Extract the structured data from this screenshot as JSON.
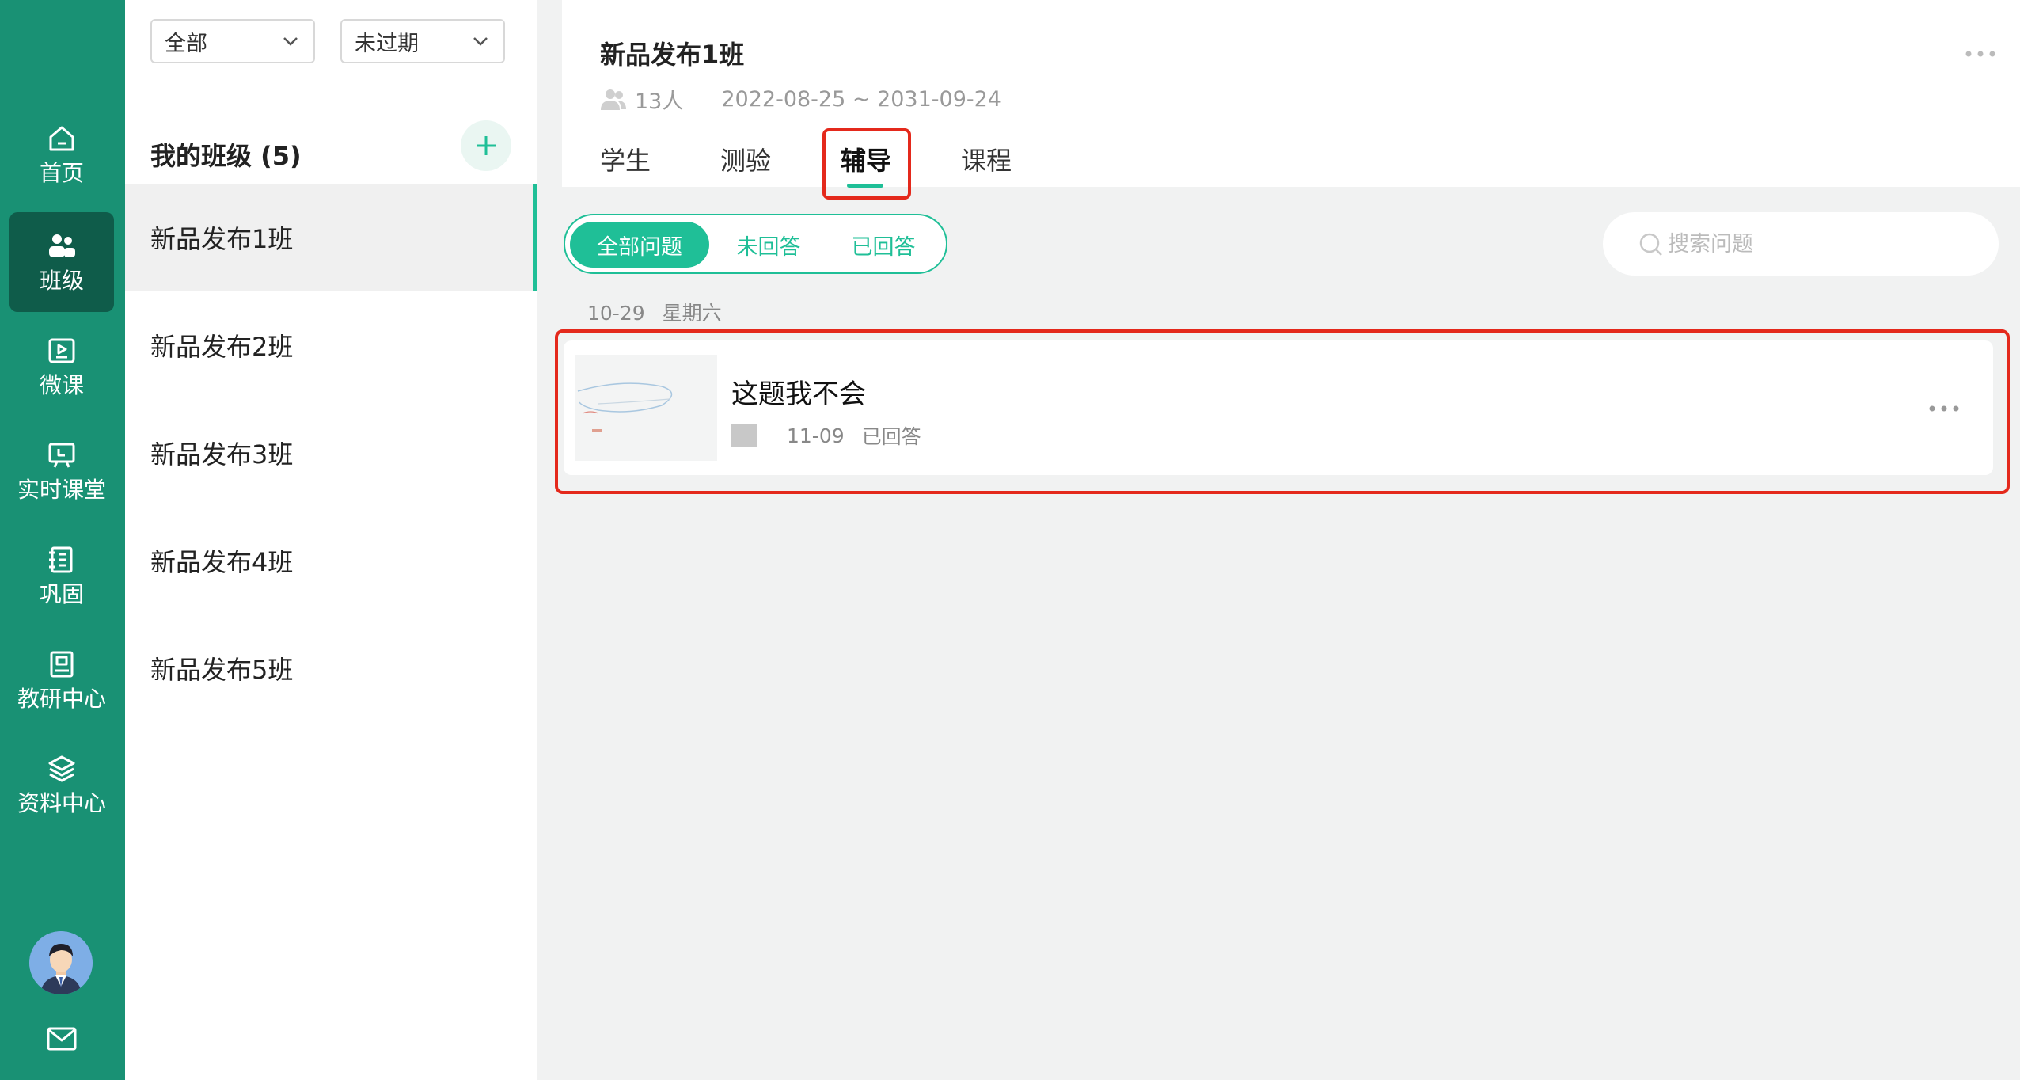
{
  "colors": {
    "rail": "#199174",
    "rail_active": "#0f5c4a",
    "accent": "#1fbf97",
    "highlight": "#e4291c"
  },
  "nav": {
    "items": [
      {
        "label": "首页",
        "icon": "home-icon"
      },
      {
        "label": "班级",
        "icon": "people-icon",
        "active": true
      },
      {
        "label": "微课",
        "icon": "video-icon"
      },
      {
        "label": "实时课堂",
        "icon": "blackboard-icon"
      },
      {
        "label": "巩固",
        "icon": "notebook-icon"
      },
      {
        "label": "教研中心",
        "icon": "book-icon"
      },
      {
        "label": "资料中心",
        "icon": "layers-icon"
      }
    ],
    "avatar": "avatar",
    "mail_icon": "mail-icon"
  },
  "filters": {
    "scope": "全部",
    "status": "未过期"
  },
  "classes": {
    "title": "我的班级 (5)",
    "items": [
      "新品发布1班",
      "新品发布2班",
      "新品发布3班",
      "新品发布4班",
      "新品发布5班"
    ],
    "active_index": 0
  },
  "header": {
    "title": "新品发布1班",
    "members": "13人",
    "period": "2022-08-25 ~ 2031-09-24",
    "tabs": [
      "学生",
      "测验",
      "辅导",
      "课程"
    ],
    "active_tab": "辅导"
  },
  "question_filter": {
    "options": [
      "全部问题",
      "未回答",
      "已回答"
    ],
    "active": "全部问题"
  },
  "search": {
    "placeholder": "搜索问题"
  },
  "date_group": {
    "date": "10-29",
    "weekday": "星期六"
  },
  "question": {
    "title": "这题我不会",
    "date": "11-09",
    "status": "已回答"
  }
}
